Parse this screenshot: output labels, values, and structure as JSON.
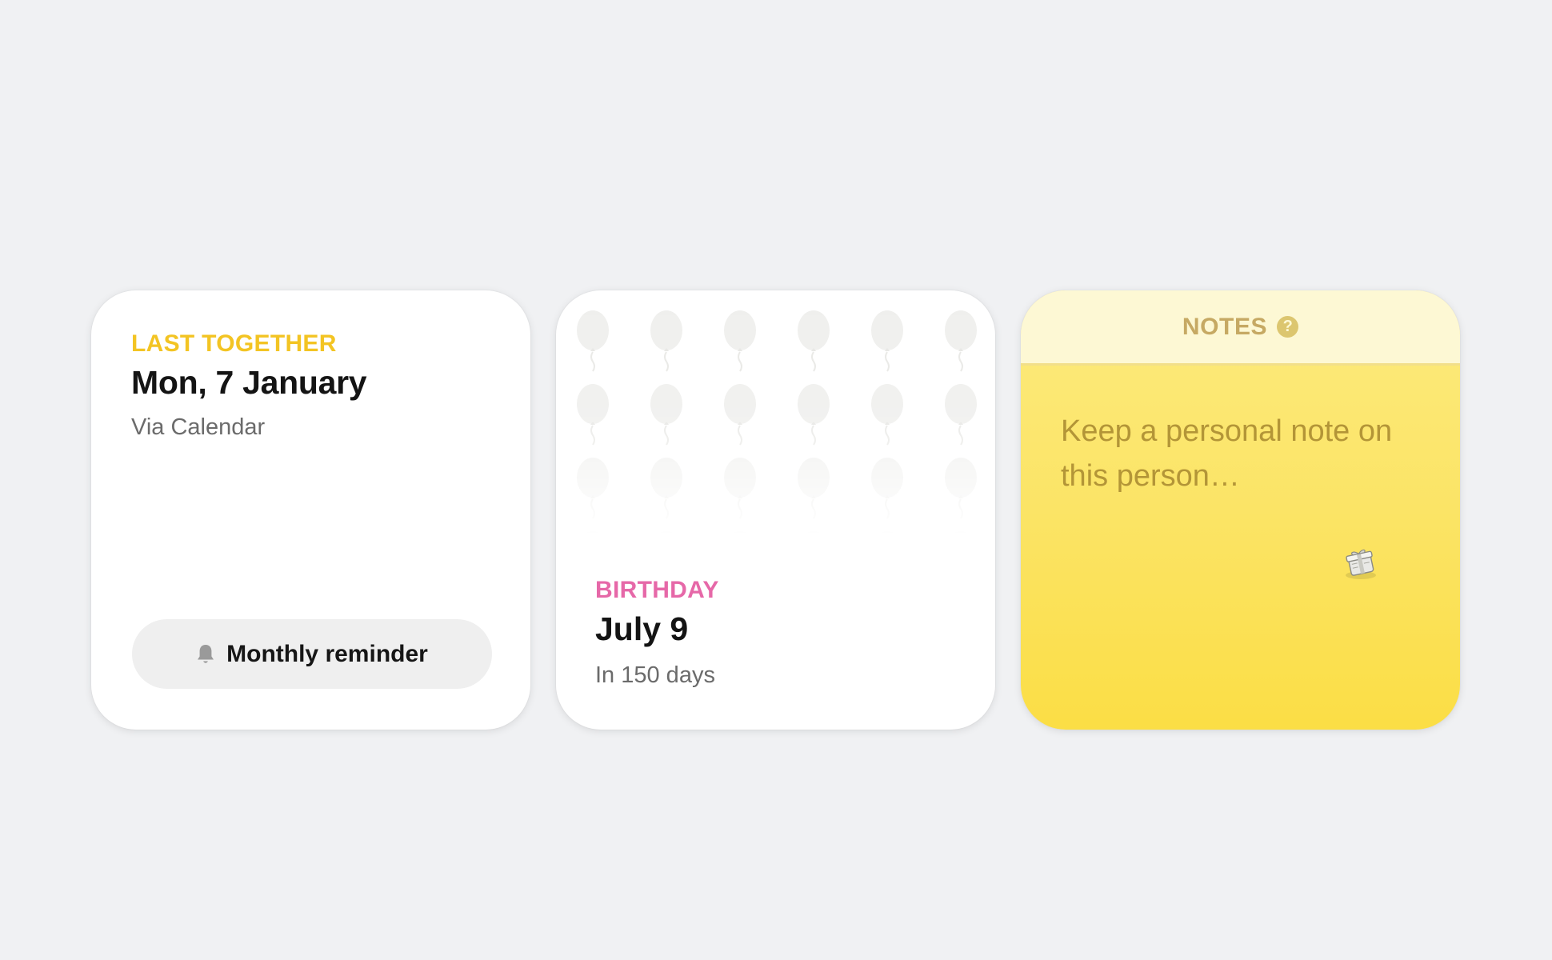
{
  "last_together": {
    "label": "LAST TOGETHER",
    "date": "Mon, 7 January",
    "source": "Via Calendar",
    "reminder_button": {
      "label": "Monthly reminder",
      "icon": "bell-icon"
    }
  },
  "birthday": {
    "label": "BIRTHDAY",
    "date": "July 9",
    "countdown": "In 150 days",
    "background_icon": "balloon-icon"
  },
  "notes": {
    "title": "NOTES",
    "help_icon": "?",
    "placeholder": "Keep a personal note on this person…",
    "sticker_icon": "gift-icon"
  },
  "colors": {
    "last_together_accent": "#f3c423",
    "birthday_accent": "#e668a8",
    "notes_header": "#fdf8d4",
    "notes_body": "#fbe466",
    "page_background": "#f0f1f3"
  }
}
